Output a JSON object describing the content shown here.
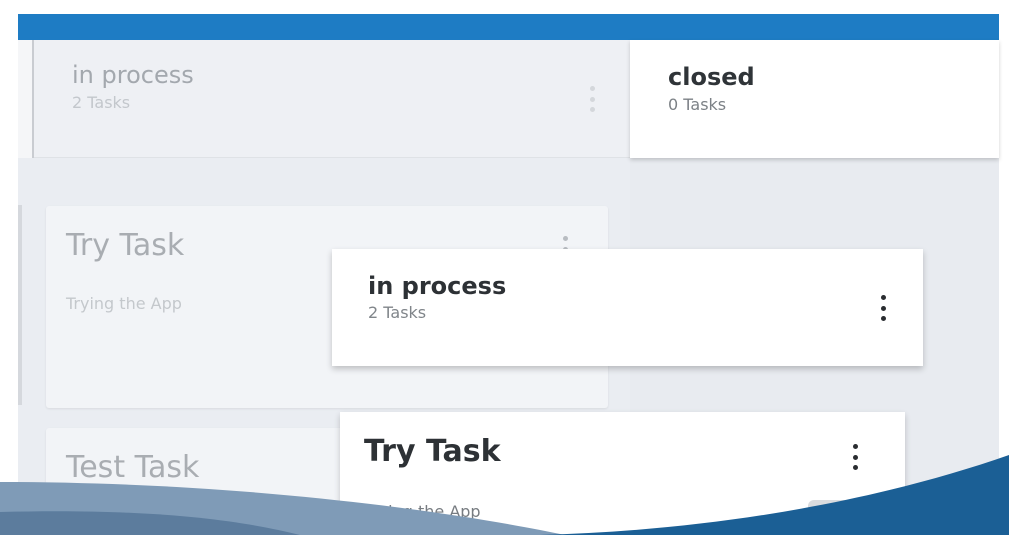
{
  "board": {
    "columns": [
      {
        "title": "in process",
        "count": "2 Tasks"
      },
      {
        "title": "closed",
        "count": "0 Tasks"
      }
    ],
    "tasks": [
      {
        "title": "Try Task",
        "description": "Trying the App"
      },
      {
        "title": "Test Task"
      }
    ]
  },
  "drag": {
    "column": {
      "title": "in process",
      "count": "2 Tasks"
    },
    "task": {
      "title": "Try Task",
      "description": "Truing the App"
    }
  },
  "colors": {
    "accent": "#1e7cc4",
    "swoosh_light": "#7f9bb7",
    "swoosh_dark": "#1b5f95"
  }
}
